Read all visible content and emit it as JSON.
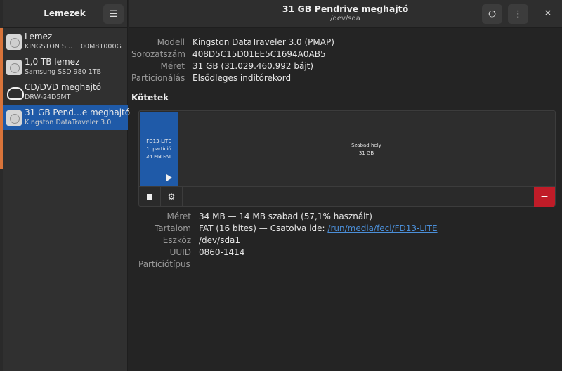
{
  "sidebar": {
    "title": "Lemezek",
    "menu_icon": "hamburger-menu-icon",
    "drives": [
      {
        "name": "Lemez",
        "sub": "KINGSTON S...",
        "sub2": "00M81000G",
        "icon": "disk-icon"
      },
      {
        "name": "1,0 TB lemez",
        "sub": "Samsung SSD 980 1TB",
        "icon": "disk-icon"
      },
      {
        "name": "CD/DVD meghajtó",
        "sub": "DRW-24D5MT",
        "icon": "optical-drive-icon"
      },
      {
        "name": "31 GB Pend…e meghajtó",
        "sub": "Kingston DataTraveler 3.0",
        "icon": "disk-icon",
        "selected": true
      }
    ]
  },
  "header": {
    "title": "31 GB Pendrive meghajtó",
    "subtitle": "/dev/sda",
    "close_label": "✕"
  },
  "drive_info": {
    "model_label": "Modell",
    "model": "Kingston DataTraveler 3.0 (PMAP)",
    "serial_label": "Sorozatszám",
    "serial": "408D5C15D01EE5C1694A0AB5",
    "size_label": "Méret",
    "size": "31 GB (31.029.460.992 bájt)",
    "partitioning_label": "Particionálás",
    "partitioning": "Elsődleges indítórekord"
  },
  "volumes": {
    "title": "Kötetek",
    "partition_lines": [
      "FD13-LITE",
      "1. partíció",
      "34 MB FAT"
    ],
    "free_lines": [
      "Szabad hely",
      "31 GB"
    ],
    "delete_label": "−"
  },
  "volume_info": {
    "size_label": "Méret",
    "size": "34 MB — 14 MB szabad (57,1% használt)",
    "content_label": "Tartalom",
    "content_prefix": "FAT (16 bites) — Csatolva ide: ",
    "content_link": "/run/media/feci/FD13-LITE",
    "device_label": "Eszköz",
    "device": "/dev/sda1",
    "uuid_label": "UUID",
    "uuid": "0860-1414",
    "parttype_label": "Partíciótípus",
    "parttype": ""
  },
  "colors": {
    "accent": "#1f5aa8",
    "danger": "#c01c28",
    "link": "#4b8fd9"
  }
}
